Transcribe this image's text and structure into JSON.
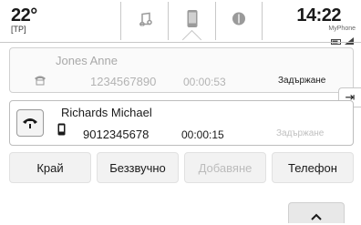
{
  "topbar": {
    "temperature": "22°",
    "temp_sub": "[TP]",
    "clock": "14:22",
    "carrier": "MyPhone",
    "tabs": [
      {
        "icon": "music-note-icon"
      },
      {
        "icon": "phone-icon"
      },
      {
        "icon": "navigation-icon"
      }
    ]
  },
  "calls": [
    {
      "name": "Jones Anne",
      "number": "1234567890",
      "duration": "00:00:53",
      "state": "Задържане",
      "icon": "phone-handset-icon"
    },
    {
      "name": "Richards Michael",
      "number": "9012345678",
      "duration": "00:00:15",
      "state": "Задържане",
      "icon": "mobile-phone-icon"
    }
  ],
  "actions": {
    "end": "Край",
    "mute": "Беззвучно",
    "add": "Добавяне",
    "phone": "Телефон"
  },
  "colors": {
    "accent_dark": "#1a1a1a",
    "inactive": "#bcbcbc",
    "border": "#c8c8c8"
  }
}
